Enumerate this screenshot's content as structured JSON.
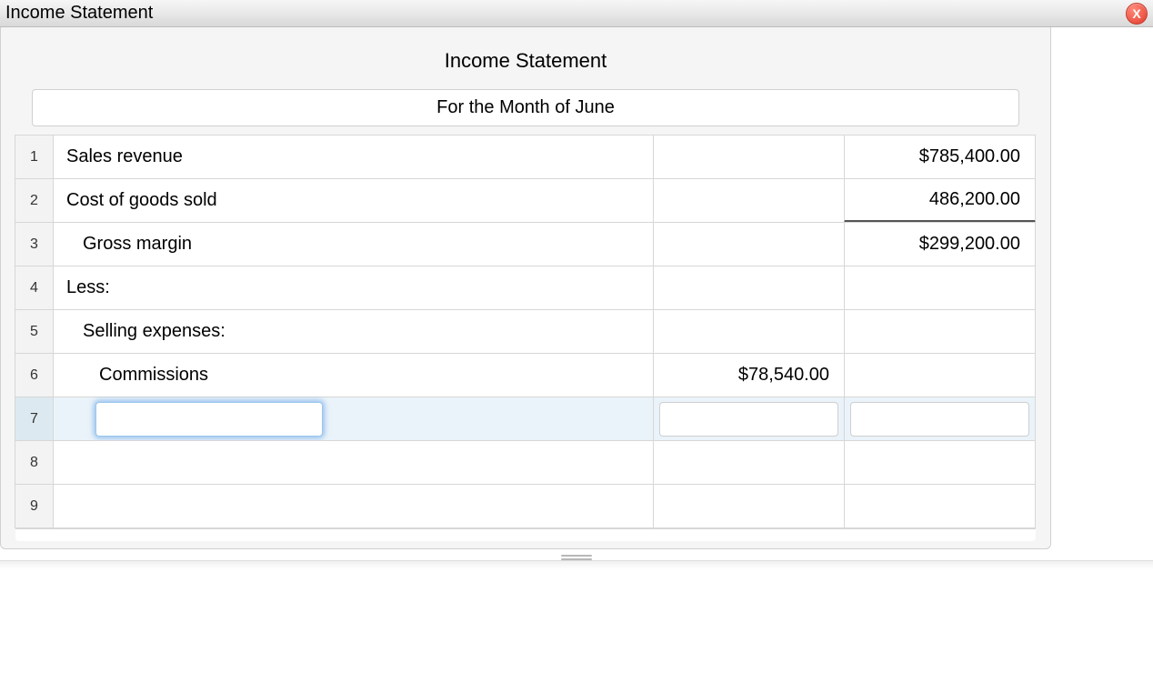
{
  "window": {
    "title": "Income Statement",
    "close_label": "X"
  },
  "header": {
    "title": "Income Statement",
    "period": "For the Month of June"
  },
  "rows": [
    {
      "num": "1",
      "label": "Sales revenue",
      "indent": 0,
      "col2": "",
      "col3": "$785,400.00",
      "col3_underline": false
    },
    {
      "num": "2",
      "label": "Cost of goods sold",
      "indent": 0,
      "col2": "",
      "col3": "486,200.00",
      "col3_underline": true
    },
    {
      "num": "3",
      "label": "Gross margin",
      "indent": 1,
      "col2": "",
      "col3": "$299,200.00",
      "col3_underline": false
    },
    {
      "num": "4",
      "label": "Less:",
      "indent": 0,
      "col2": "",
      "col3": "",
      "col3_underline": false
    },
    {
      "num": "5",
      "label": "Selling expenses:",
      "indent": 1,
      "col2": "",
      "col3": "",
      "col3_underline": false
    },
    {
      "num": "6",
      "label": "Commissions",
      "indent": 2,
      "col2": "$78,540.00",
      "col3": "",
      "col3_underline": false
    }
  ],
  "active_row": {
    "num": "7",
    "label_value": "",
    "col2_value": "",
    "col3_value": ""
  },
  "blank_rows": [
    {
      "num": "8"
    },
    {
      "num": "9"
    }
  ]
}
